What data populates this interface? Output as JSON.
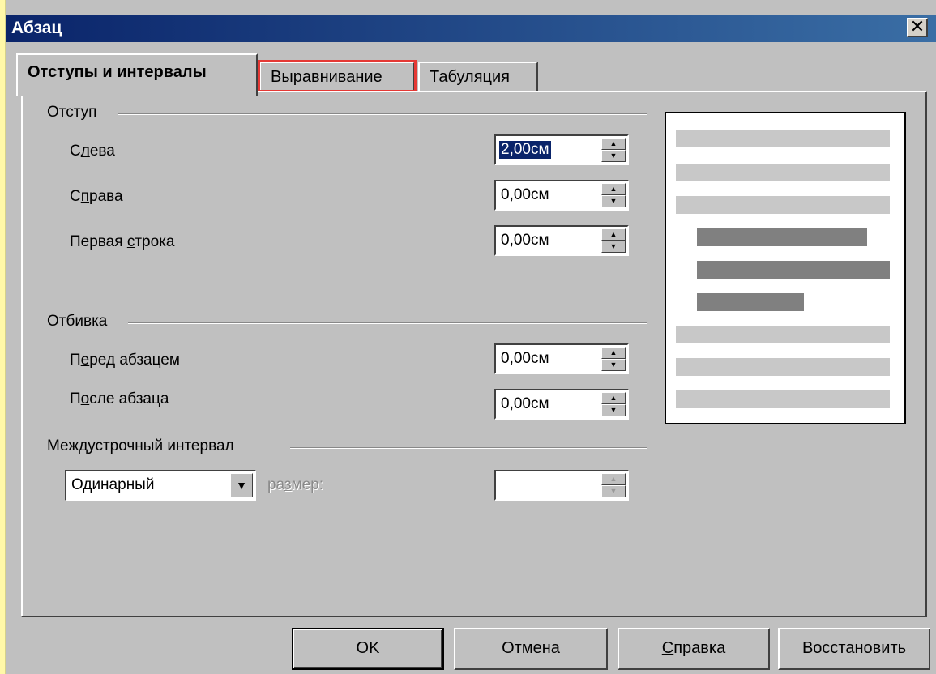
{
  "window": {
    "title": "Абзац",
    "close_glyph": "✕"
  },
  "tabs": [
    {
      "label": "Отступы и интервалы",
      "active": true
    },
    {
      "label": "Выравнивание",
      "highlighted": true
    },
    {
      "label": "Табуляция"
    }
  ],
  "indent": {
    "heading": "Отступ",
    "left": {
      "label_pre": "С",
      "label_u": "л",
      "label_post": "ева",
      "value": "2,00см"
    },
    "right": {
      "label_pre": "С",
      "label_u": "п",
      "label_post": "рава",
      "value": "0,00см"
    },
    "first_line": {
      "label_pre": "Первая ",
      "label_u": "с",
      "label_post": "трока",
      "value": "0,00см"
    }
  },
  "spacing": {
    "heading": "Отбивка",
    "before": {
      "label_pre": "П",
      "label_u": "е",
      "label_post": "ред абзацем",
      "value": "0,00см"
    },
    "after": {
      "label_pre": "П",
      "label_u": "о",
      "label_post": "сле абзаца",
      "value": "0,00см"
    }
  },
  "line_spacing": {
    "heading": "Междустрочный интервал",
    "selected": "Одинарный",
    "size_label_pre": "ра",
    "size_label_u": "з",
    "size_label_post": "мер:",
    "size_value": ""
  },
  "buttons": {
    "ok": "OK",
    "cancel": "Отмена",
    "help_u": "С",
    "help_rest": "правка",
    "reset": "Восстановить"
  },
  "colors": {
    "highlight": "#e53935",
    "title_bar": "#0a246a",
    "preview_light": "#c8c8c8",
    "preview_dark": "#808080"
  }
}
